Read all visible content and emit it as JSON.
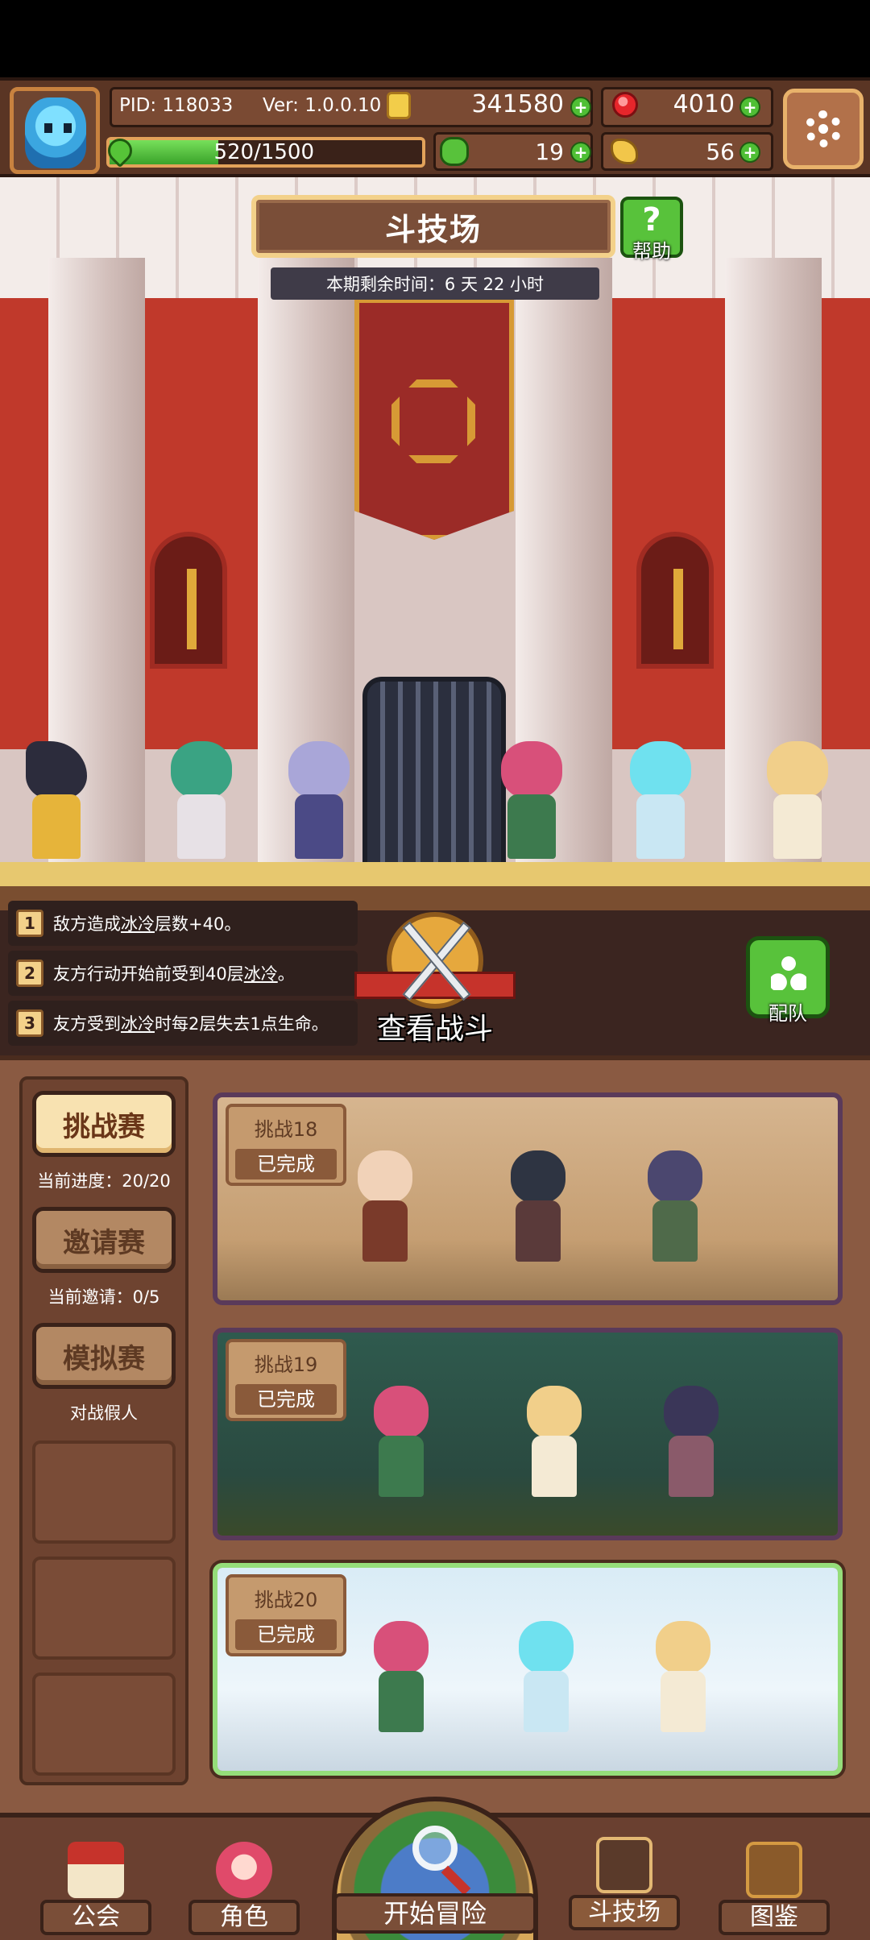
{
  "header": {
    "pid": "PID: 118033",
    "version": "Ver: 1.0.0.10",
    "coins": "341580",
    "gems": "4010",
    "exp": "520/1500",
    "exp_fraction": 0.347,
    "clover": "19",
    "keys": "56",
    "icons": [
      "avatar",
      "coin-icon",
      "ruby-icon",
      "exp-leaf-icon",
      "clover-icon",
      "key-icon",
      "gear-icon",
      "plus-icon"
    ]
  },
  "arena": {
    "title": "斗技场",
    "help_label": "帮助",
    "help_glyph": "?",
    "timer": "本期剩余时间：6 天 22 小时"
  },
  "rules": [
    {
      "num": "1",
      "pre": "敌方造成",
      "term": "冰冷",
      "post": "层数+40。"
    },
    {
      "num": "2",
      "pre": "友方行动开始前受到40层",
      "term": "冰冷",
      "post": "。"
    },
    {
      "num": "3",
      "pre": "友方受到",
      "term": "冰冷",
      "post": "时每2层失去1点生命。"
    }
  ],
  "battle": {
    "view_label": "查看战斗",
    "team_label": "配队"
  },
  "modes": [
    {
      "label": "挑战赛",
      "sub": "当前进度：20/20",
      "active": true
    },
    {
      "label": "邀请赛",
      "sub": "当前邀请：0/5",
      "active": false
    },
    {
      "label": "模拟赛",
      "sub": "对战假人",
      "active": false
    }
  ],
  "challenges": [
    {
      "title": "挑战18",
      "status": "已完成"
    },
    {
      "title": "挑战19",
      "status": "已完成"
    },
    {
      "title": "挑战20",
      "status": "已完成"
    }
  ],
  "nav": {
    "guild": "公会",
    "character": "角色",
    "adventure": "开始冒险",
    "arena": "斗技场",
    "codex": "图鉴"
  },
  "colors": {
    "accent_green": "#58c23b",
    "wood_dark": "#5a3524",
    "gold": "#f3d18a",
    "red_wall": "#c0392b"
  }
}
